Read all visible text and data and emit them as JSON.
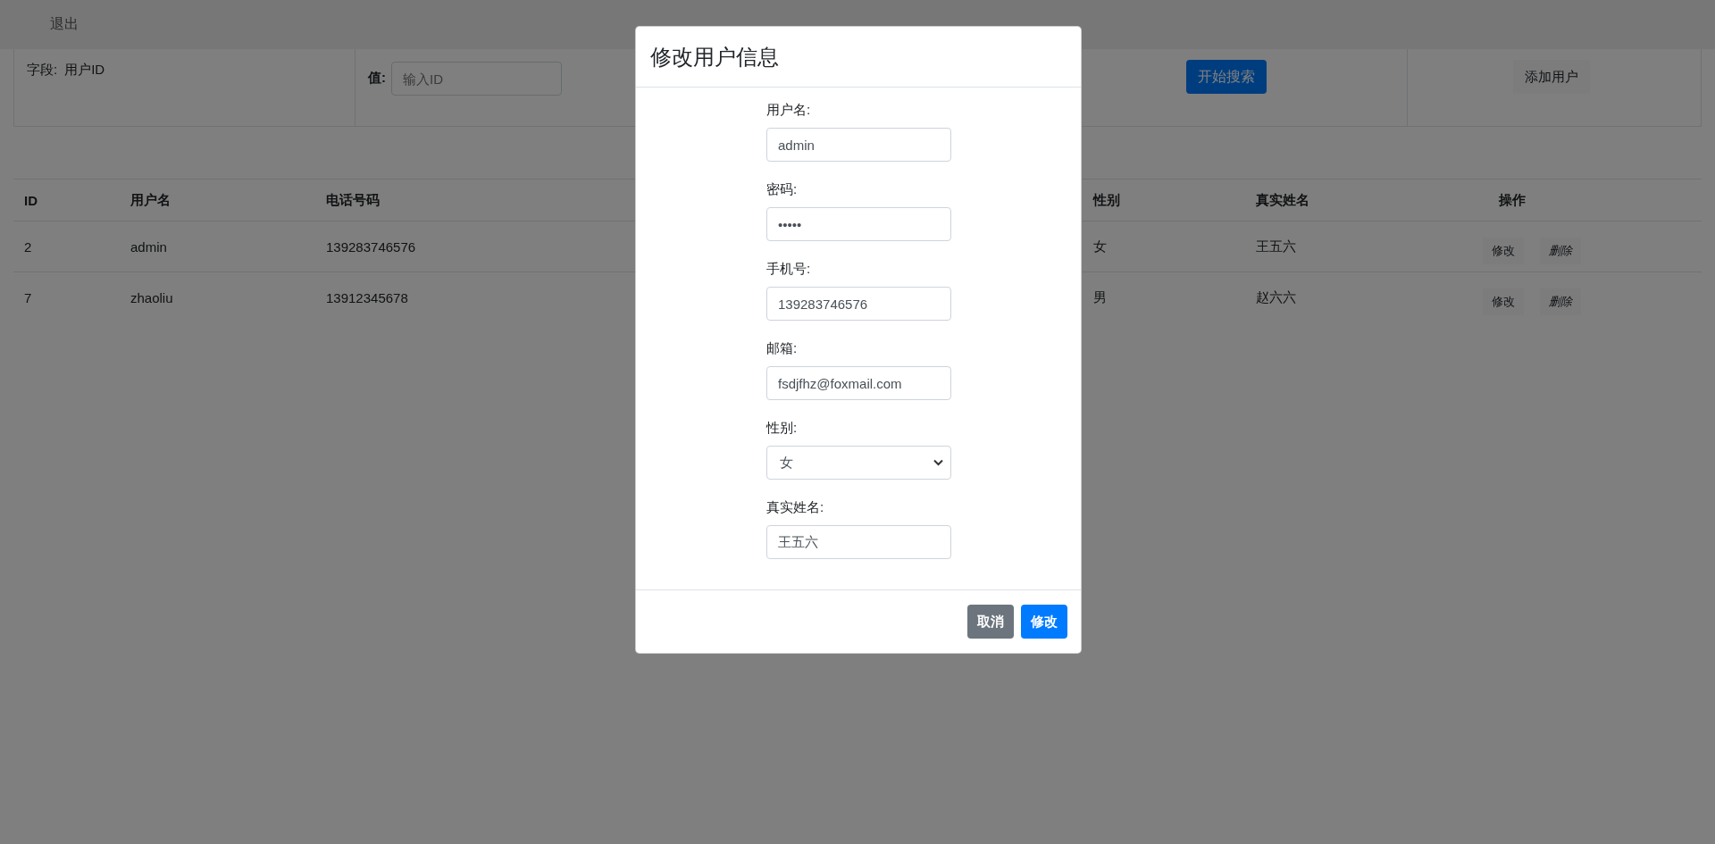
{
  "nav": {
    "logout": "退出"
  },
  "search": {
    "field_label": "字段:",
    "field_value": "用户ID",
    "value_label": "值:",
    "placeholder": "输入ID",
    "search_button": "开始搜索",
    "add_button": "添加用户"
  },
  "table": {
    "columns": [
      "ID",
      "用户名",
      "电话号码",
      "性别",
      "真实姓名",
      "操作"
    ],
    "rows": [
      {
        "cells": [
          "2",
          "admin",
          "139283746576",
          "女",
          "王五六"
        ],
        "actions": [
          "修改",
          "删除"
        ]
      },
      {
        "cells": [
          "7",
          "zhaoliu",
          "13912345678",
          "男",
          "赵六六"
        ],
        "actions": [
          "修改",
          "删除"
        ]
      }
    ]
  },
  "modal": {
    "title": "修改用户信息",
    "fields": [
      {
        "kind": "text",
        "label": "用户名:",
        "value": "admin"
      },
      {
        "kind": "text",
        "label": "密码:",
        "value": "•••••"
      },
      {
        "kind": "text",
        "label": "手机号:",
        "value": "139283746576"
      },
      {
        "kind": "text",
        "label": "邮箱:",
        "value": "fsdjfhz@foxmail.com"
      },
      {
        "kind": "select",
        "label": "性别:",
        "value": "女"
      },
      {
        "kind": "text",
        "label": "真实姓名:",
        "value": "王五六"
      }
    ],
    "buttons": [
      {
        "kind": "secondary",
        "label": "取消"
      },
      {
        "kind": "primary",
        "label": "修改"
      }
    ]
  }
}
